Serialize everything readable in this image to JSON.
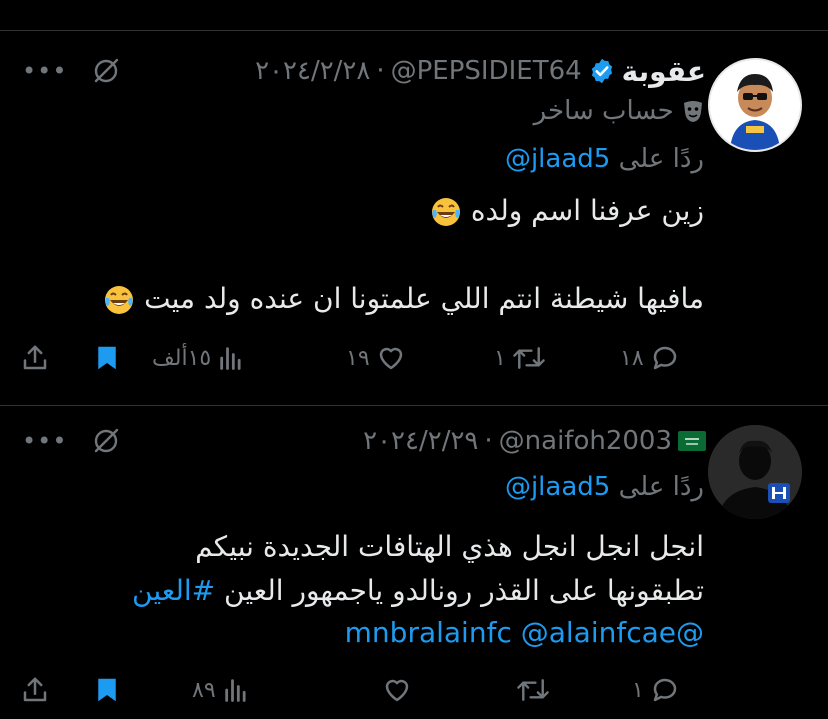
{
  "tweets": [
    {
      "author_name": "عقوبة",
      "handle": "@PEPSIDIET64",
      "separator": "·",
      "date": "٢٠٢٤/٢/٢٨",
      "verified": true,
      "parody_label": "حساب ساخر",
      "reply_prefix": "ردًا على",
      "reply_to": "@jlaad5",
      "lines": [
        "زين عرفنا اسم ولده",
        "مافيها شيطنة انتم اللي علمتونا ان عنده ولد ميت"
      ],
      "emoji": "laughing-tears",
      "stats": {
        "replies": "١٨",
        "retweets": "١",
        "likes": "١٩",
        "views": "١٥ألف"
      }
    },
    {
      "author_name": "",
      "handle": "@naifoh2003",
      "separator": "·",
      "date": "٢٠٢٤/٢/٢٩",
      "flag": "saudi-flag",
      "reply_prefix": "ردًا على",
      "reply_to": "@jlaad5",
      "lines": [
        "انجل انجل انجل هذي الهتافات الجديدة نبيكم",
        "تطبقونها على القذر رونالدو ياجمهور العين"
      ],
      "hashtag": "#العين",
      "mentions": "@mnbralainfc @alainfcae",
      "stats": {
        "replies": "١",
        "retweets": "",
        "likes": "",
        "views": "٨٩"
      }
    }
  ],
  "colors": {
    "background": "#000000",
    "text": "#e7e9ea",
    "muted": "#71767b",
    "accent": "#1d9bf0",
    "divider": "#2f3336"
  }
}
